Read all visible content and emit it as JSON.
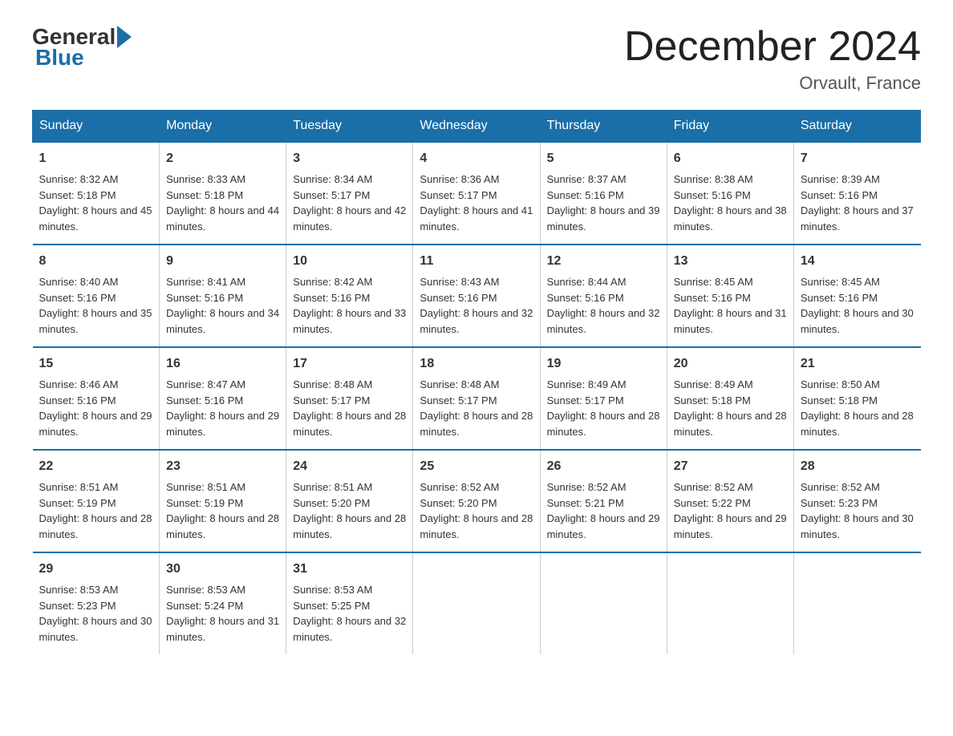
{
  "logo": {
    "general": "General",
    "blue": "Blue"
  },
  "title": "December 2024",
  "subtitle": "Orvault, France",
  "weekdays": [
    "Sunday",
    "Monday",
    "Tuesday",
    "Wednesday",
    "Thursday",
    "Friday",
    "Saturday"
  ],
  "weeks": [
    [
      {
        "day": "1",
        "sunrise": "8:32 AM",
        "sunset": "5:18 PM",
        "daylight": "8 hours and 45 minutes."
      },
      {
        "day": "2",
        "sunrise": "8:33 AM",
        "sunset": "5:18 PM",
        "daylight": "8 hours and 44 minutes."
      },
      {
        "day": "3",
        "sunrise": "8:34 AM",
        "sunset": "5:17 PM",
        "daylight": "8 hours and 42 minutes."
      },
      {
        "day": "4",
        "sunrise": "8:36 AM",
        "sunset": "5:17 PM",
        "daylight": "8 hours and 41 minutes."
      },
      {
        "day": "5",
        "sunrise": "8:37 AM",
        "sunset": "5:16 PM",
        "daylight": "8 hours and 39 minutes."
      },
      {
        "day": "6",
        "sunrise": "8:38 AM",
        "sunset": "5:16 PM",
        "daylight": "8 hours and 38 minutes."
      },
      {
        "day": "7",
        "sunrise": "8:39 AM",
        "sunset": "5:16 PM",
        "daylight": "8 hours and 37 minutes."
      }
    ],
    [
      {
        "day": "8",
        "sunrise": "8:40 AM",
        "sunset": "5:16 PM",
        "daylight": "8 hours and 35 minutes."
      },
      {
        "day": "9",
        "sunrise": "8:41 AM",
        "sunset": "5:16 PM",
        "daylight": "8 hours and 34 minutes."
      },
      {
        "day": "10",
        "sunrise": "8:42 AM",
        "sunset": "5:16 PM",
        "daylight": "8 hours and 33 minutes."
      },
      {
        "day": "11",
        "sunrise": "8:43 AM",
        "sunset": "5:16 PM",
        "daylight": "8 hours and 32 minutes."
      },
      {
        "day": "12",
        "sunrise": "8:44 AM",
        "sunset": "5:16 PM",
        "daylight": "8 hours and 32 minutes."
      },
      {
        "day": "13",
        "sunrise": "8:45 AM",
        "sunset": "5:16 PM",
        "daylight": "8 hours and 31 minutes."
      },
      {
        "day": "14",
        "sunrise": "8:45 AM",
        "sunset": "5:16 PM",
        "daylight": "8 hours and 30 minutes."
      }
    ],
    [
      {
        "day": "15",
        "sunrise": "8:46 AM",
        "sunset": "5:16 PM",
        "daylight": "8 hours and 29 minutes."
      },
      {
        "day": "16",
        "sunrise": "8:47 AM",
        "sunset": "5:16 PM",
        "daylight": "8 hours and 29 minutes."
      },
      {
        "day": "17",
        "sunrise": "8:48 AM",
        "sunset": "5:17 PM",
        "daylight": "8 hours and 28 minutes."
      },
      {
        "day": "18",
        "sunrise": "8:48 AM",
        "sunset": "5:17 PM",
        "daylight": "8 hours and 28 minutes."
      },
      {
        "day": "19",
        "sunrise": "8:49 AM",
        "sunset": "5:17 PM",
        "daylight": "8 hours and 28 minutes."
      },
      {
        "day": "20",
        "sunrise": "8:49 AM",
        "sunset": "5:18 PM",
        "daylight": "8 hours and 28 minutes."
      },
      {
        "day": "21",
        "sunrise": "8:50 AM",
        "sunset": "5:18 PM",
        "daylight": "8 hours and 28 minutes."
      }
    ],
    [
      {
        "day": "22",
        "sunrise": "8:51 AM",
        "sunset": "5:19 PM",
        "daylight": "8 hours and 28 minutes."
      },
      {
        "day": "23",
        "sunrise": "8:51 AM",
        "sunset": "5:19 PM",
        "daylight": "8 hours and 28 minutes."
      },
      {
        "day": "24",
        "sunrise": "8:51 AM",
        "sunset": "5:20 PM",
        "daylight": "8 hours and 28 minutes."
      },
      {
        "day": "25",
        "sunrise": "8:52 AM",
        "sunset": "5:20 PM",
        "daylight": "8 hours and 28 minutes."
      },
      {
        "day": "26",
        "sunrise": "8:52 AM",
        "sunset": "5:21 PM",
        "daylight": "8 hours and 29 minutes."
      },
      {
        "day": "27",
        "sunrise": "8:52 AM",
        "sunset": "5:22 PM",
        "daylight": "8 hours and 29 minutes."
      },
      {
        "day": "28",
        "sunrise": "8:52 AM",
        "sunset": "5:23 PM",
        "daylight": "8 hours and 30 minutes."
      }
    ],
    [
      {
        "day": "29",
        "sunrise": "8:53 AM",
        "sunset": "5:23 PM",
        "daylight": "8 hours and 30 minutes."
      },
      {
        "day": "30",
        "sunrise": "8:53 AM",
        "sunset": "5:24 PM",
        "daylight": "8 hours and 31 minutes."
      },
      {
        "day": "31",
        "sunrise": "8:53 AM",
        "sunset": "5:25 PM",
        "daylight": "8 hours and 32 minutes."
      },
      {
        "day": "",
        "sunrise": "",
        "sunset": "",
        "daylight": ""
      },
      {
        "day": "",
        "sunrise": "",
        "sunset": "",
        "daylight": ""
      },
      {
        "day": "",
        "sunrise": "",
        "sunset": "",
        "daylight": ""
      },
      {
        "day": "",
        "sunrise": "",
        "sunset": "",
        "daylight": ""
      }
    ]
  ]
}
